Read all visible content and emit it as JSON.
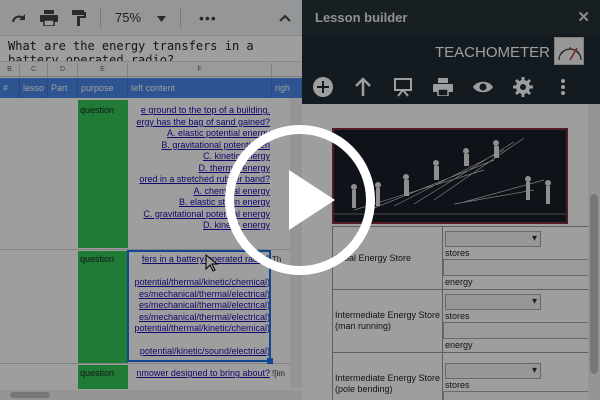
{
  "sheet": {
    "zoom": "75%",
    "formula": {
      "line1": "What are the energy transfers in a",
      "line2": "battery operated radio?"
    },
    "columns": [
      "B",
      "C",
      "D",
      "E",
      "F"
    ],
    "header": {
      "c1": "#",
      "c2": "lesso",
      "c3": "Part",
      "c4": "purpose",
      "c5": "left content",
      "c6": "righ"
    },
    "rows": [
      {
        "purpose": "question",
        "lines": [
          "e ground to the top of a building.",
          "ergy has the bag of sand gained?",
          "A. elastic potential energy",
          "B. gravitational potential en",
          "C. kinetic energy",
          "D. thermal energy",
          "ored in a stretched rubber band?",
          "A. chemical energy",
          "B. elastic strain energy",
          "C. gravitational potential energy",
          "D. kinetic energy"
        ]
      },
      {
        "purpose": "question",
        "right": "Th",
        "lines": [
          "fers in a battery-operated radio?",
          "",
          "potential/thermal/kinetic/chemical)",
          "es/mechanical/thermal/electrical)",
          "es/mechanical/thermal/electrical)",
          "es/mechanical/thermal/electrical)",
          "potential/thermal/kinetic/chemical)",
          "",
          "potential/kinetic/sound/electrical)"
        ]
      },
      {
        "purpose": "question",
        "right": "![im",
        "lines": [
          "nmower designed to bring about?"
        ]
      }
    ]
  },
  "builder": {
    "title": "Lesson builder",
    "brand": "TEACHOMETER",
    "table": [
      {
        "name": "Initial Energy Store",
        "l1": "stores",
        "l2": "energy"
      },
      {
        "name": "Intermediate Energy Store (man running)",
        "l1": "stores",
        "l2": "energy"
      },
      {
        "name": "Intermediate Energy Store (pole bending)",
        "l1": "stores",
        "l2": ""
      }
    ]
  },
  "colors": {
    "header_blue": "#4a86e8",
    "purpose_green": "#34c759",
    "builder_dark": "#1f2a35",
    "link_text": "#1a0dab"
  },
  "icons": [
    "redo-icon",
    "print-icon",
    "paint-format-icon",
    "add-icon",
    "arrow-up-icon",
    "presentation-icon",
    "print-icon",
    "preview-eye-icon",
    "settings-gear-icon",
    "more-vert-icon",
    "close-icon",
    "play-icon"
  ]
}
